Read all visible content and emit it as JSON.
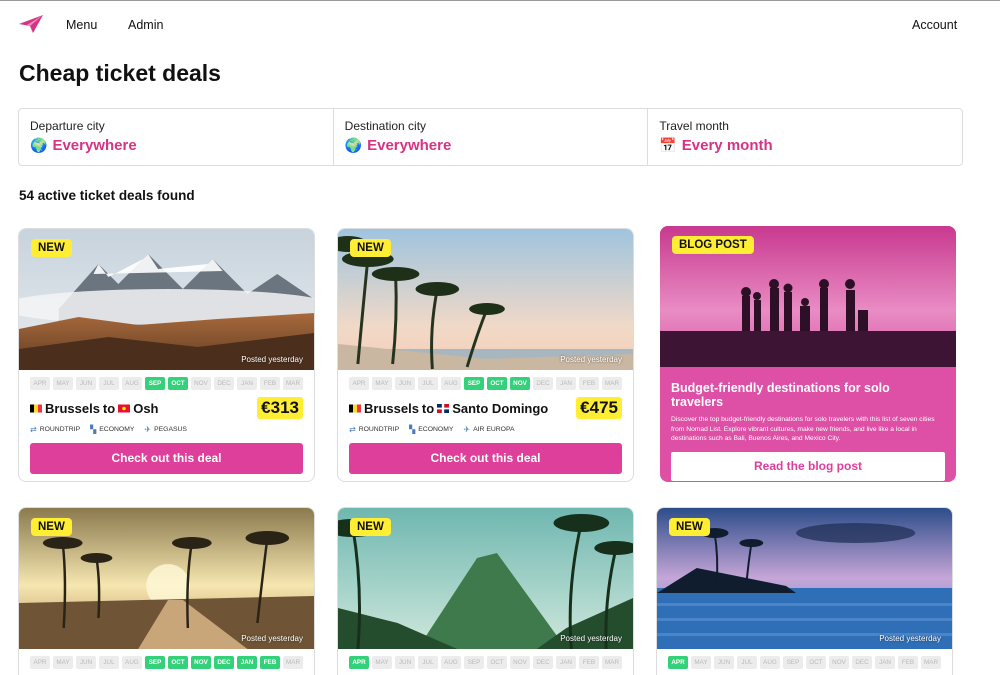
{
  "nav": {
    "logo_icon": "paper-plane-icon",
    "menu": "Menu",
    "admin": "Admin",
    "account": "Account"
  },
  "page_title": "Cheap ticket deals",
  "filters": [
    {
      "label": "Departure city",
      "value": "Everywhere",
      "icon": "globe-icon",
      "glyph": "🌍"
    },
    {
      "label": "Destination city",
      "value": "Everywhere",
      "icon": "globe-icon",
      "glyph": "🌍"
    },
    {
      "label": "Travel month",
      "value": "Every month",
      "icon": "calendar-icon",
      "glyph": "📅"
    }
  ],
  "results_text": "54 active ticket deals found",
  "months": [
    "APR",
    "MAY",
    "JUN",
    "JUL",
    "AUG",
    "SEP",
    "OCT",
    "NOV",
    "DEC",
    "JAN",
    "FEB",
    "MAR"
  ],
  "deals": [
    {
      "badge": "NEW",
      "posted": "Posted yesterday",
      "active_months": [
        "SEP",
        "OCT"
      ],
      "from": "Brussels",
      "to": "Osh",
      "from_flag": "BE",
      "to_flag": "KG",
      "price": "€313",
      "trip": "ROUNDTRIP",
      "cabin": "ECONOMY",
      "airline": "PEGASUS",
      "cta": "Check out this deal",
      "scene": "mountains"
    },
    {
      "badge": "NEW",
      "posted": "Posted yesterday",
      "active_months": [
        "SEP",
        "OCT",
        "NOV"
      ],
      "from": "Brussels",
      "to": "Santo Domingo",
      "from_flag": "BE",
      "to_flag": "DO",
      "price": "€475",
      "trip": "ROUNDTRIP",
      "cabin": "ECONOMY",
      "airline": "AIR EUROPA",
      "cta": "Check out this deal",
      "scene": "beach"
    },
    {
      "badge": "NEW",
      "posted": "Posted yesterday",
      "active_months": [
        "SEP",
        "OCT",
        "NOV",
        "DEC",
        "JAN",
        "FEB"
      ],
      "scene": "sunset-road"
    },
    {
      "badge": "NEW",
      "posted": "Posted yesterday",
      "active_months": [
        "APR"
      ],
      "scene": "jungle"
    },
    {
      "badge": "NEW",
      "posted": "Posted yesterday",
      "active_months": [
        "APR"
      ],
      "scene": "lagoon"
    }
  ],
  "blog": {
    "badge": "BLOG POST",
    "title": "Budget-friendly destinations for solo travelers",
    "description": "Discover the top budget-friendly destinations for solo travelers with this list of seven cities from Nomad List. Explore vibrant cultures, make new friends, and live like a local in destinations such as Bali, Buenos Aires, and Mexico City.",
    "button": "Read the blog post"
  },
  "colors": {
    "accent": "#de3f9b",
    "badge": "#ffee33",
    "month_active": "#33d17a",
    "blog_bg": "#de4fa6"
  }
}
